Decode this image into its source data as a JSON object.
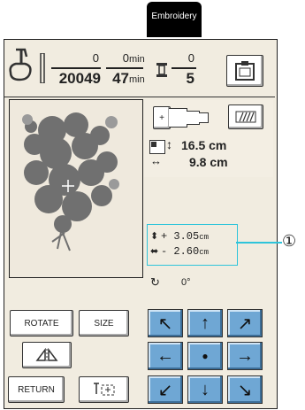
{
  "tab": {
    "label": "Embroidery"
  },
  "status": {
    "stitch_top": "0",
    "stitch_bottom": "20049",
    "time_top": "0",
    "time_top_unit": "min",
    "time_bottom": "47",
    "time_bottom_unit": "min",
    "color_top": "0",
    "color_bottom": "5"
  },
  "size_display": {
    "height": "16.5 cm",
    "width": "9.8 cm"
  },
  "position": {
    "vertical": "+ 3.05",
    "vertical_unit": "cm",
    "horizontal": "- 2.60",
    "horizontal_unit": "cm"
  },
  "rotation": {
    "value": "0°"
  },
  "buttons": {
    "rotate": "ROTATE",
    "size": "SIZE",
    "return": "RETURN"
  },
  "callout": {
    "label": "①"
  },
  "colors": {
    "arrow_blue": "#6fa7d4",
    "callout_cyan": "#2ec4da",
    "flower_gray": "#707070"
  }
}
